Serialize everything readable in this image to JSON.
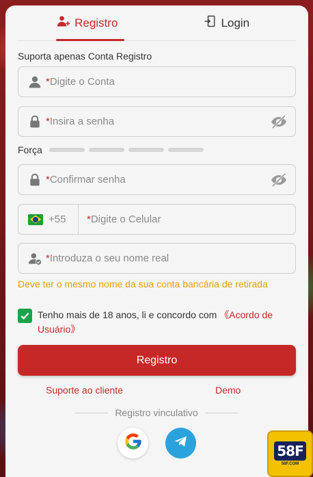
{
  "tabs": [
    {
      "label": "Registro",
      "icon": "user-add-icon",
      "active": true
    },
    {
      "label": "Login",
      "icon": "login-door-icon",
      "active": false
    }
  ],
  "support_note": "Suporta apenas Conta Registro",
  "fields": {
    "account": {
      "required_mark": "*",
      "placeholder": "Digite o Conta",
      "icon": "user-icon"
    },
    "password": {
      "required_mark": "*",
      "placeholder": "Insira a senha",
      "icon": "lock-icon"
    },
    "confirm": {
      "required_mark": "*",
      "placeholder": "Confirmar senha",
      "icon": "lock-icon"
    },
    "phone": {
      "country_code": "+55",
      "required_mark": "*",
      "placeholder": "Digite o Celular",
      "flag": "brazil-flag"
    },
    "real_name": {
      "required_mark": "*",
      "placeholder": "Introduza o seu nome real",
      "icon": "user-check-icon"
    }
  },
  "strength": {
    "label": "Força",
    "level": 0,
    "bars": 4
  },
  "name_hint": "Deve ter o mesmo nome da sua conta bancária de retirada",
  "agreement": {
    "checked": true,
    "text": "Tenho mais de 18 anos, li e concordo com ",
    "link": "《Acordo de Usuário》"
  },
  "submit_label": "Registro",
  "links": {
    "support": "Suporte ao cliente",
    "demo": "Demo"
  },
  "divider_text": "Registro vinculativo",
  "social": [
    "google-icon",
    "telegram-icon"
  ],
  "badge": {
    "logo": "58F",
    "domain": "58F.COM"
  },
  "colors": {
    "accent": "#c62828",
    "hint": "#e6a100",
    "check": "#1aa34a"
  }
}
